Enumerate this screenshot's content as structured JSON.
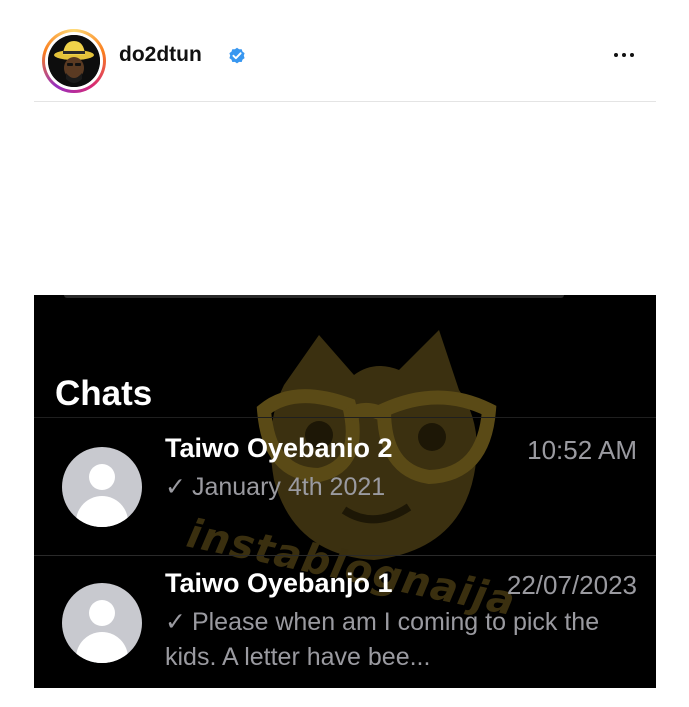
{
  "post": {
    "username": "do2dtun",
    "verified_icon": "verified-badge-icon",
    "more_icon": "more-options-icon",
    "colors": {
      "verified": "#3897f0",
      "story_ring": [
        "#feda75",
        "#fa7e1e",
        "#d62976",
        "#962fbf"
      ]
    }
  },
  "screenshot": {
    "title": "Chats",
    "watermark": "instablognaija",
    "chats": [
      {
        "name": "Taiwo Oyebanio 2",
        "time": "10:52 AM",
        "status_icon": "checkmark-icon",
        "check": "✓",
        "preview": "January 4th 2021"
      },
      {
        "name": "Taiwo Oyebanjo 1",
        "time": "22/07/2023",
        "status_icon": "checkmark-icon",
        "check": "✓",
        "preview": "Please when am I coming to pick the kids. A letter have bee..."
      }
    ],
    "colors": {
      "background": "#000000",
      "secondary_text": "#9a9aa0",
      "avatar_placeholder": "#c8c9cf"
    }
  }
}
